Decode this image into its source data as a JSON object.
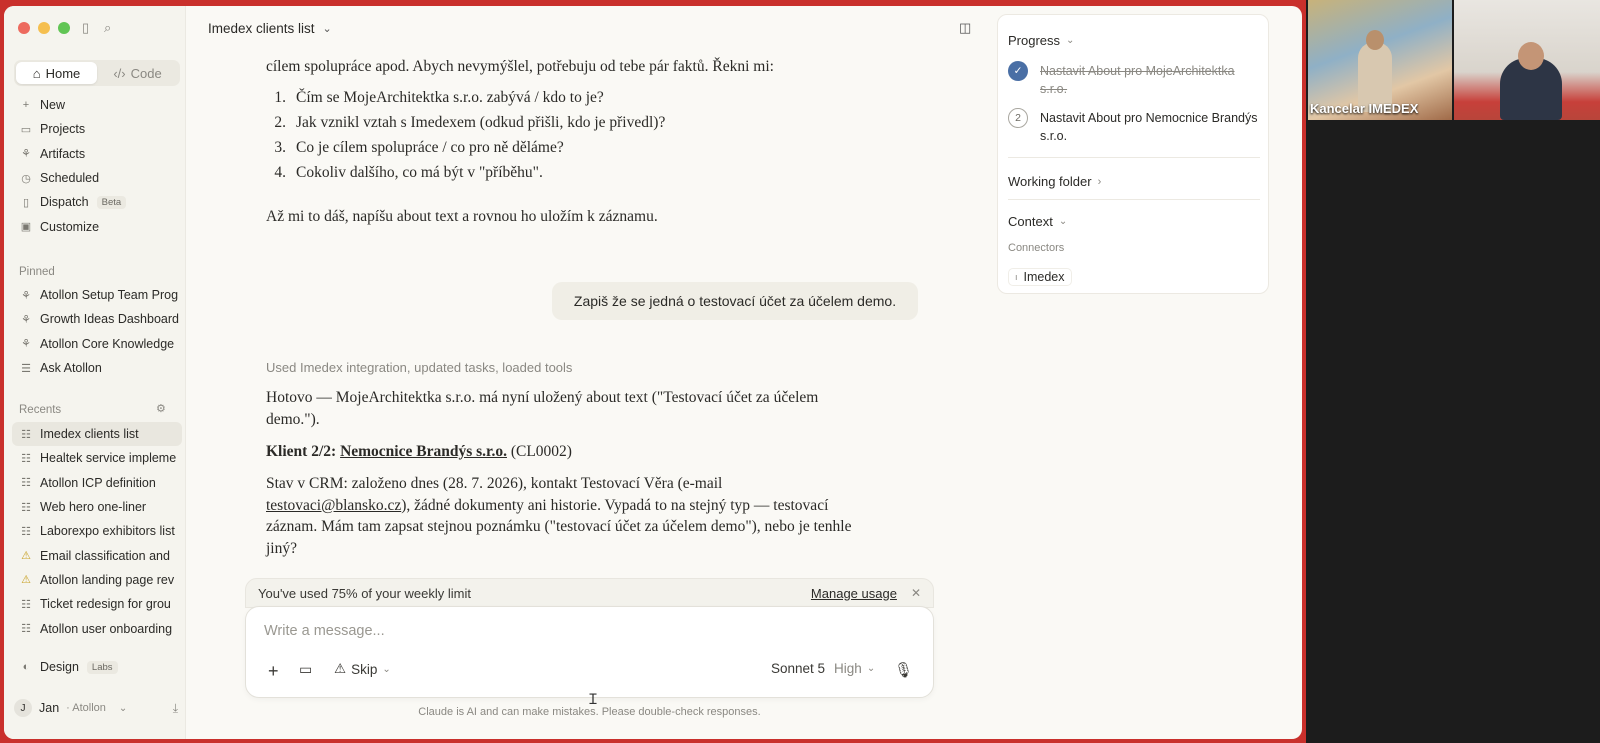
{
  "sidebar": {
    "home": "Home",
    "code": "Code",
    "nav": [
      {
        "label": "New",
        "icon": "plus-icon"
      },
      {
        "label": "Projects",
        "icon": "folder-icon"
      },
      {
        "label": "Artifacts",
        "icon": "artifacts-icon"
      },
      {
        "label": "Scheduled",
        "icon": "clock-icon"
      },
      {
        "label": "Dispatch",
        "icon": "phone-icon",
        "badge": "Beta"
      },
      {
        "label": "Customize",
        "icon": "briefcase-icon"
      }
    ],
    "pinned_label": "Pinned",
    "pinned": [
      {
        "label": "Atollon Setup Team Prog"
      },
      {
        "label": "Growth Ideas Dashboard"
      },
      {
        "label": "Atollon Core Knowledge"
      },
      {
        "label": "Ask Atollon"
      }
    ],
    "recents_label": "Recents",
    "recents": [
      {
        "label": "Imedex clients list"
      },
      {
        "label": "Healtek service impleme"
      },
      {
        "label": "Atollon ICP definition"
      },
      {
        "label": "Web hero one-liner"
      },
      {
        "label": "Laborexpo exhibitors list"
      },
      {
        "label": "Email classification and"
      },
      {
        "label": "Atollon landing page rev"
      },
      {
        "label": "Ticket redesign for grou"
      },
      {
        "label": "Atollon user onboarding"
      }
    ],
    "design": "Design",
    "labs": "Labs",
    "user_initial": "J",
    "user_name": "Jan",
    "user_org": "· Atollon"
  },
  "header": {
    "title": "Imedex clients list"
  },
  "conversation": {
    "intro": "cílem spolupráce apod. Abych nevymýšlel, potřebuju od tebe pár faktů. Řekni mi:",
    "questions": [
      {
        "n": "1.",
        "text": "Čím se MojeArchitektka s.r.o. zabývá / kdo to je?"
      },
      {
        "n": "2.",
        "text": "Jak vznikl vztah s Imedexem (odkud přišli, kdo je přivedl)?"
      },
      {
        "n": "3.",
        "text": "Co je cílem spolupráce / co pro ně děláme?"
      },
      {
        "n": "4.",
        "text": "Cokoliv dalšího, co má být v \"příběhu\"."
      }
    ],
    "followup": "Až mi to dáš, napíšu about text a rovnou ho uložím k záznamu.",
    "user_msg": "Zapiš že se jedná o testovací účet za účelem demo.",
    "used_tools": "Used Imedex integration, updated tasks, loaded tools",
    "reply1": "Hotovo — MojeArchitektka s.r.o. má nyní uložený about text (\"Testovací účet za účelem demo.\").",
    "client_prefix": "Klient 2/2: ",
    "client_name": "Nemocnice Brandýs s.r.o.",
    "client_code": " (CL0002)",
    "reply2_a": "Stav v CRM: založeno dnes (28. 7. 2026), kontakt Testovací Věra (e-mail ",
    "reply2_email": "testovaci@blansko.cz",
    "reply2_b": "), žádné dokumenty ani historie. Vypadá to na stejný typ — testovací záznam. Mám tam zapsat stejnou poznámku (\"testovací účet za účelem demo\"), nebo je tenhle jiný?"
  },
  "limit_bar": {
    "text": "You've used 75% of your weekly limit",
    "manage": "Manage usage"
  },
  "composer": {
    "placeholder": "Write a message...",
    "skip": "Skip",
    "model": "Sonnet 5",
    "effort": "High"
  },
  "disclaimer": "Claude is AI and can make mistakes. Please double-check responses.",
  "right_panel": {
    "progress_label": "Progress",
    "steps": [
      {
        "num": "✓",
        "text": "Nastavit About pro MojeArchitektka s.r.o.",
        "done": true
      },
      {
        "num": "2",
        "text": "Nastavit About pro Nemocnice Brandýs s.r.o.",
        "done": false
      }
    ],
    "working_folder": "Working folder",
    "context_label": "Context",
    "connectors_label": "Connectors",
    "connector": "Imedex"
  },
  "video": {
    "name": "Kancelar IMEDEX"
  },
  "colors": {
    "accent": "#4a6fa5",
    "frame": "#c9302c"
  }
}
